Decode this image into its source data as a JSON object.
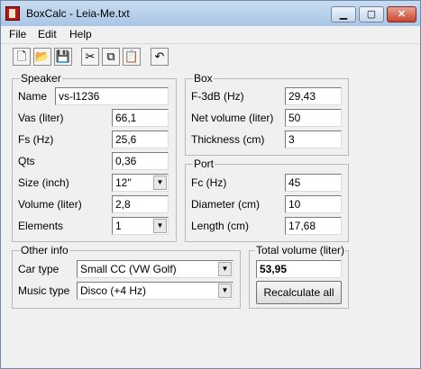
{
  "window": {
    "title": "BoxCalc - Leia-Me.txt",
    "controls": {
      "min": "▁",
      "max": "▢",
      "close": "✕"
    }
  },
  "menu": [
    "File",
    "Edit",
    "Help"
  ],
  "toolbar": [
    {
      "name": "new-icon",
      "glyph": "🗋"
    },
    {
      "name": "open-folder-icon",
      "glyph": "📂"
    },
    {
      "name": "save-icon",
      "glyph": "💾"
    },
    {
      "name": "cut-icon",
      "glyph": "✂"
    },
    {
      "name": "copy-icon",
      "glyph": "⧉"
    },
    {
      "name": "paste-icon",
      "glyph": "📋"
    },
    {
      "name": "undo-icon",
      "glyph": "↶"
    }
  ],
  "speaker": {
    "legend": "Speaker",
    "name_label": "Name",
    "name_value": "vs-l1236",
    "vas_label": "Vas (liter)",
    "vas_value": "66,1",
    "fs_label": "Fs (Hz)",
    "fs_value": "25,6",
    "qts_label": "Qts",
    "qts_value": "0,36",
    "size_label": "Size (inch)",
    "size_value": "12''",
    "volume_label": "Volume (liter)",
    "volume_value": "2,8",
    "elements_label": "Elements",
    "elements_value": "1"
  },
  "box": {
    "legend": "Box",
    "f3db_label": "F-3dB (Hz)",
    "f3db_value": "29,43",
    "netvol_label": "Net volume (liter)",
    "netvol_value": "50",
    "thickness_label": "Thickness (cm)",
    "thickness_value": "3"
  },
  "port": {
    "legend": "Port",
    "fc_label": "Fc (Hz)",
    "fc_value": "45",
    "diameter_label": "Diameter (cm)",
    "diameter_value": "10",
    "length_label": "Length (cm)",
    "length_value": "17,68"
  },
  "other": {
    "legend": "Other info",
    "car_label": "Car type",
    "car_value": "Small CC  (VW Golf)",
    "music_label": "Music type",
    "music_value": "Disco  (+4 Hz)"
  },
  "total": {
    "legend": "Total volume (liter)",
    "value": "53,95",
    "button": "Recalculate all"
  },
  "arrow_glyph": "▼"
}
